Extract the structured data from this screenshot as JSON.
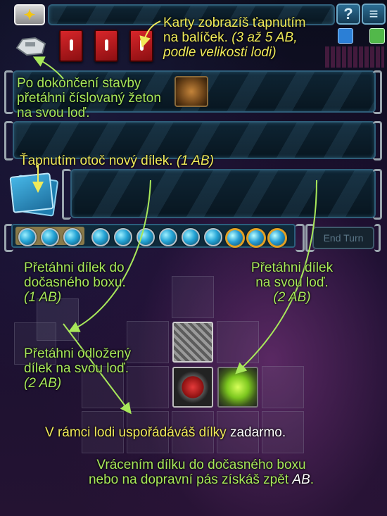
{
  "top_bar": {
    "question_icon_glyph": "?",
    "menu_icon_glyph": "≡"
  },
  "hints": {
    "cards_line1": "Karty zobrazíš ťapnutím",
    "cards_line2": "na balíček.",
    "cards_line2_italic": "(3 až 5 AB,",
    "cards_line3_italic": "podle velikosti lodi)",
    "finish_line1": "Po dokončení stavby",
    "finish_line2": "přetáhni číslovaný žeton",
    "finish_line3": "na svou loď.",
    "flip_text": "Ťapnutím otoč nový dílek.",
    "flip_italic": "(1 AB)",
    "drag_box_line1": "Přetáhni dílek do",
    "drag_box_line2": "dočasného boxu.",
    "drag_box_line3": "(1 AB)",
    "drag_ship_line1": "Přetáhni dílek",
    "drag_ship_line2": "na svou loď.",
    "drag_ship_line3": "(2 AB)",
    "drag_stored_line1": "Přetáhni odložený",
    "drag_stored_line2": "dílek na svou loď.",
    "drag_stored_line3": "(2 AB)",
    "arrange_text": "V rámci lodi uspořádáváš dílky",
    "arrange_free": "zadarmo.",
    "return_line1": "Vrácením dílku do dočasného boxu",
    "return_line2": "nebo na dopravní pás získáš zpět",
    "return_ab": "AB",
    "return_end": "."
  },
  "progress": {
    "blue_beads": 9,
    "gold_beads": 4
  },
  "end_turn_label": "End Turn",
  "colors": {
    "hint_green": "#a8e85a",
    "hint_yellow": "#f0ea5a",
    "card_red": "#d8262a",
    "panel_border": "#2e5d78"
  }
}
